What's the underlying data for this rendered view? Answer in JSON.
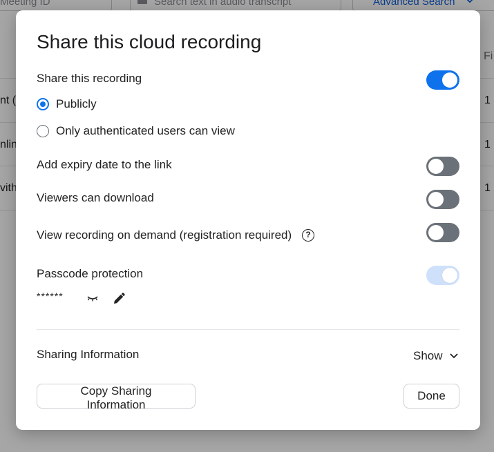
{
  "background": {
    "meeting_id_placeholder": "Meeting ID",
    "transcript_placeholder": "Search text in audio transcript",
    "advanced_search_label": "Advanced Search",
    "column_header_partial": "Fi",
    "row_left_partials": [
      "nt (",
      "nline",
      "vith"
    ],
    "row_right_values": [
      "1",
      "1",
      "1"
    ]
  },
  "dialog": {
    "title": "Share this cloud recording",
    "share_recording": {
      "label": "Share this recording",
      "enabled": true
    },
    "visibility_options": [
      {
        "label": "Publicly",
        "selected": true
      },
      {
        "label": "Only authenticated users can view",
        "selected": false
      }
    ],
    "expiry": {
      "label": "Add expiry date to the link",
      "enabled": false
    },
    "download": {
      "label": "Viewers can download",
      "enabled": false
    },
    "on_demand": {
      "label": "View recording on demand (registration required)",
      "enabled": false
    },
    "passcode": {
      "label": "Passcode protection",
      "enabled": true,
      "locked": true,
      "masked_value": "******"
    },
    "sharing_info": {
      "label": "Sharing Information",
      "toggle_label": "Show"
    },
    "buttons": {
      "copy": "Copy Sharing Information",
      "done": "Done"
    }
  },
  "colors": {
    "accent": "#0e72ed",
    "toggle_off": "#6b7178",
    "toggle_disabled_on": "#cfe0fb",
    "overlay": "rgba(0,0,0,0.35)"
  },
  "icons": {
    "help": "question-circle-icon",
    "hidden": "eye-closed-icon",
    "edit": "pencil-icon",
    "chevron": "chevron-down-icon"
  }
}
